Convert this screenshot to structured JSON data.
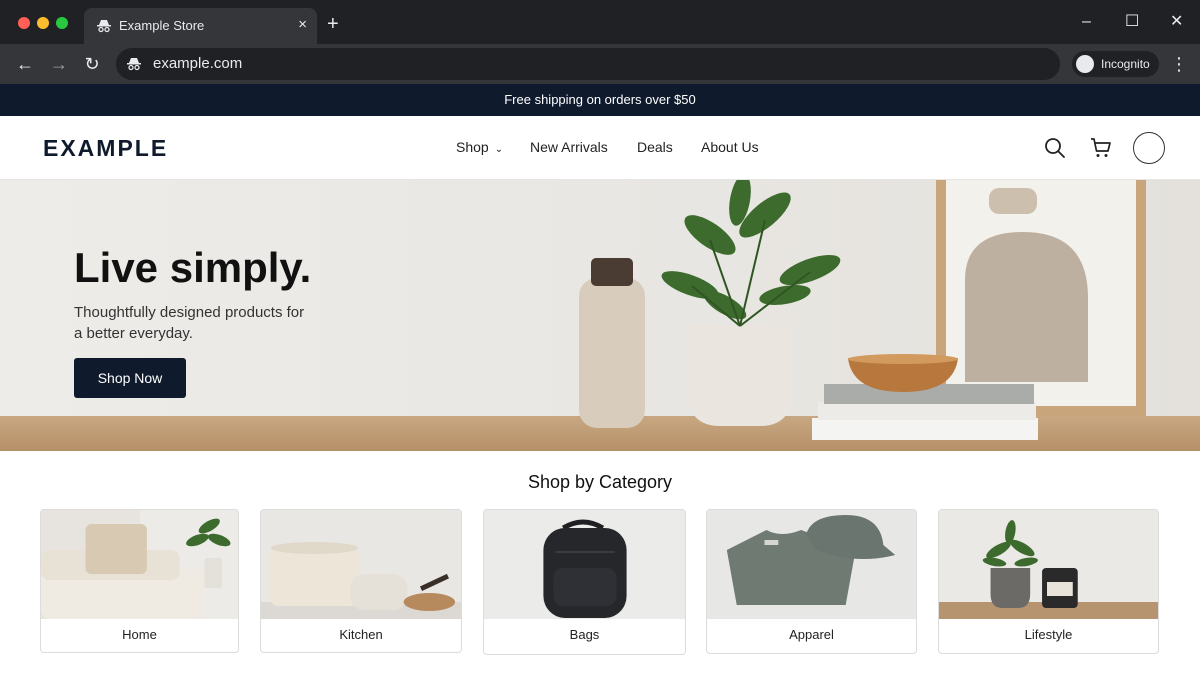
{
  "browser": {
    "tab_title": "Example Store",
    "tab_close": "×",
    "new_tab": "+",
    "url": "example.com",
    "mode_label": "Incognito",
    "window_controls": {
      "minimize": "–",
      "maximize": "☐",
      "close": "✕"
    },
    "nav": {
      "back": "←",
      "forward": "→",
      "reload": "↻",
      "menu": "⋮"
    }
  },
  "promo_bar": {
    "text": "Free shipping on orders over $50"
  },
  "header": {
    "logo": "EXAMPLE",
    "nav": [
      {
        "label": "Shop",
        "has_dropdown": true
      },
      {
        "label": "New Arrivals"
      },
      {
        "label": "Deals"
      },
      {
        "label": "About Us"
      }
    ],
    "icons": [
      "search-icon",
      "cart-icon",
      "avatar"
    ]
  },
  "hero": {
    "title": "Live simply.",
    "subtitle": "Thoughtfully designed products for a better everyday.",
    "cta": "Shop Now"
  },
  "categories": {
    "title": "Shop by Category",
    "items": [
      {
        "label": "Home"
      },
      {
        "label": "Kitchen"
      },
      {
        "label": "Bags"
      },
      {
        "label": "Apparel"
      },
      {
        "label": "Lifestyle"
      }
    ]
  },
  "colors": {
    "brand_navy": "#0f1b2d",
    "chrome_dark": "#202124",
    "chrome_toolbar": "#35363a"
  }
}
